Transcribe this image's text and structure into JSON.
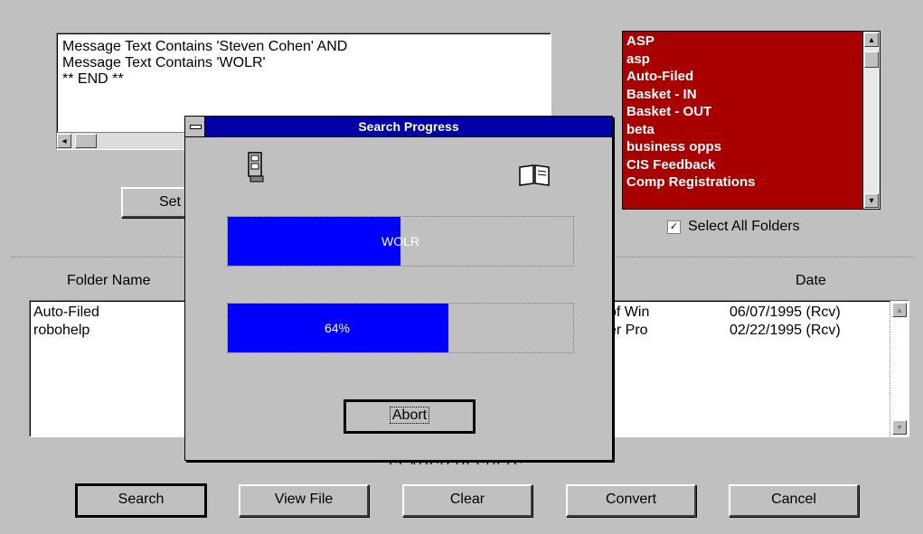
{
  "query": {
    "lines": [
      "Message Text Contains 'Steven Cohen' AND",
      "Message Text Contains 'WOLR'",
      "** END **"
    ]
  },
  "folders": {
    "items": [
      "ASP",
      "asp",
      "Auto-Filed",
      "Basket - IN",
      "Basket - OUT",
      "beta",
      "business opps",
      "CIS Feedback",
      "Comp Registrations"
    ],
    "bg_color": "#a80000",
    "select_all_label": "Select All Folders",
    "select_all_checked": true
  },
  "set_button": {
    "label": "Set C"
  },
  "results": {
    "header_folder": "Folder Name",
    "header_date": "Date",
    "rows": [
      {
        "folder": "Auto-Filed",
        "subject": "of Win",
        "date": "06/07/1995 (Rcv)"
      },
      {
        "folder": "robohelp",
        "subject": "er Pro",
        "date": "02/22/1995 (Rcv)"
      }
    ],
    "caption": "SEARCH RESULTS"
  },
  "buttons": {
    "search": "Search",
    "view_file": "View File",
    "clear": "Clear",
    "convert": "Convert",
    "cancel": "Cancel"
  },
  "progress_dialog": {
    "title": "Search Progress",
    "title_bar_color": "#0000a8",
    "current_item": "WOLR",
    "current_fill": 0.5,
    "percent_label": "64%",
    "percent_fill": 0.64,
    "abort_label": "Abort",
    "fill_color": "#0000ff",
    "icons": {
      "source": "file-cabinet-icon",
      "target": "open-book-icon"
    }
  }
}
